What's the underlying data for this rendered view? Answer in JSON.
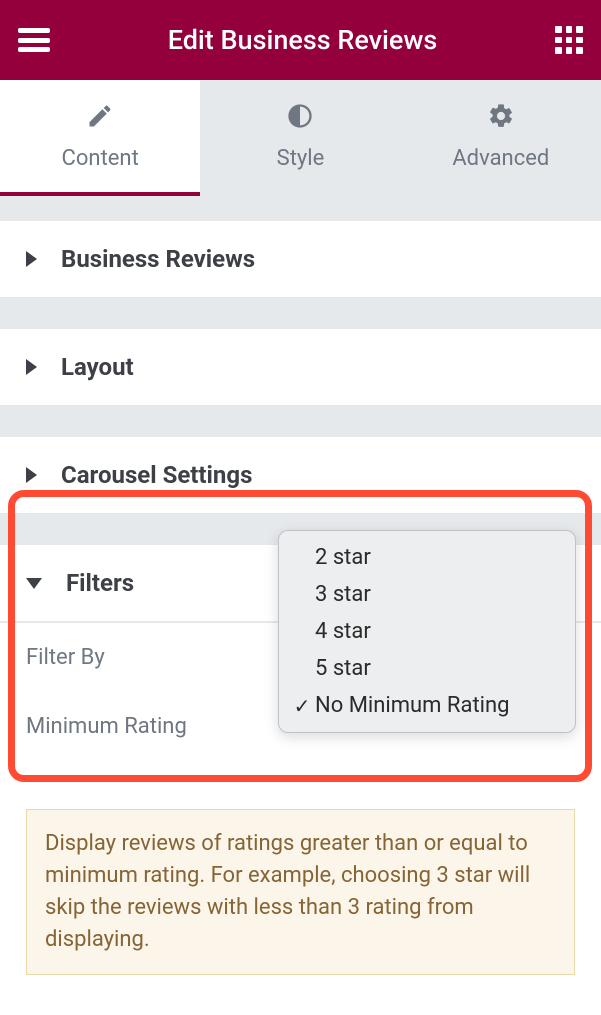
{
  "header": {
    "title": "Edit Business Reviews"
  },
  "tabs": {
    "content": "Content",
    "style": "Style",
    "advanced": "Advanced"
  },
  "sections": {
    "business_reviews": "Business Reviews",
    "layout": "Layout",
    "carousel": "Carousel Settings",
    "filters": "Filters"
  },
  "filters": {
    "filter_by_label": "Filter By",
    "min_rating_label": "Minimum Rating"
  },
  "dropdown": {
    "options": [
      {
        "label": "2 star",
        "selected": false
      },
      {
        "label": "3 star",
        "selected": false
      },
      {
        "label": "4 star",
        "selected": false
      },
      {
        "label": "5 star",
        "selected": false
      },
      {
        "label": "No Minimum Rating",
        "selected": true
      }
    ]
  },
  "note_text": "Display reviews of ratings greater than or equal to minimum rating. For example, choosing 3 star will skip the reviews with less than 3 rating from displaying."
}
